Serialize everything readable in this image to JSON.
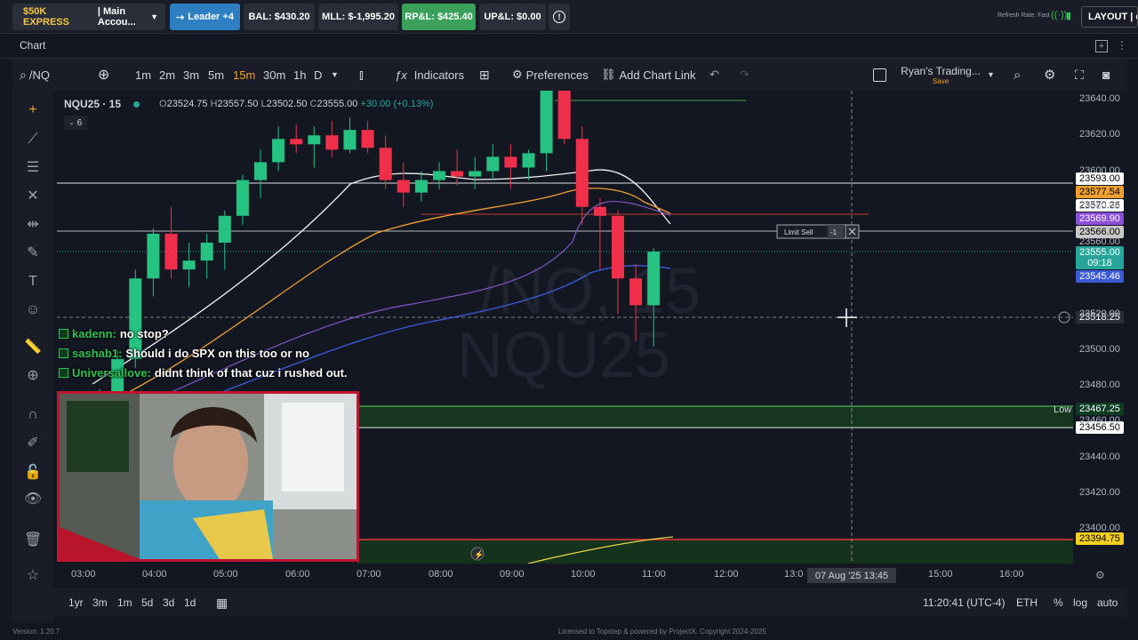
{
  "topbar": {
    "account_prefix": "$50K EXPRESS",
    "account_suffix": "| Main Accou...",
    "leader": "Leader +4",
    "bal": "BAL: $430.20",
    "mll": "MLL: $-1,995.20",
    "rpl": "RP&L: $425.40",
    "upl": "UP&L: $0.00",
    "refresh": "Refresh Rate: Fast",
    "layout": "LAYOUT | de"
  },
  "chart_tab": "Chart",
  "toolbar": {
    "symbol": "/NQ",
    "timeframes": [
      "1m",
      "2m",
      "3m",
      "5m",
      "15m",
      "30m",
      "1h",
      "D"
    ],
    "active_timeframe": "15m",
    "indicators": "Indicators",
    "preferences": "Preferences",
    "add_chart_link": "Add Chart Link",
    "layout_name": "Ryan's Trading...",
    "save": "Save"
  },
  "legend": {
    "title": "NQU25 · 15",
    "o": "23524.75",
    "h": "23557.50",
    "l": "23502.50",
    "c": "23555.00",
    "chg": "+30.00 (+0.13%)",
    "collapse": "6"
  },
  "watermark": {
    "line1": "/NQ, 15",
    "line2": "NQU25"
  },
  "order": {
    "label": "Limit Sell",
    "qty": "-1"
  },
  "low_label": "Low",
  "yaxis": {
    "ticks": [
      "23640.00",
      "23620.00",
      "23600.00",
      "23580.00",
      "23560.00",
      "23520.00",
      "23500.00",
      "23480.00",
      "23460.00",
      "23440.00",
      "23420.00",
      "23400.00"
    ],
    "tags": [
      {
        "text": "23593.00",
        "color": "#ffffff"
      },
      {
        "text": "23577.54",
        "color": "#f0a030"
      },
      {
        "text": "23570.26",
        "color": "#ffffff"
      },
      {
        "text": "23569.90",
        "color": "#8a4fd6"
      },
      {
        "text": "23566.00",
        "color": "#c8c8c8"
      },
      {
        "text": "23555.00",
        "color": "#26a69a"
      },
      {
        "text": "09:18",
        "color": "#26a69a"
      },
      {
        "text": "23545.46",
        "color": "#3b5bd6"
      },
      {
        "text": "23518.25",
        "color": "#2a2e39"
      },
      {
        "text": "23467.25",
        "color": "#0f3d22"
      },
      {
        "text": "23456.50",
        "color": "#ffffff"
      },
      {
        "text": "23394.75",
        "color": "#f5d020"
      }
    ]
  },
  "xaxis": {
    "ticks": [
      "03:00",
      "04:00",
      "05:00",
      "06:00",
      "07:00",
      "08:00",
      "09:00",
      "10:00",
      "11:00",
      "12:00",
      "13:0",
      "15:00",
      "16:00"
    ],
    "crosshair_time": "07 Aug '25  13:45"
  },
  "chat": [
    {
      "user": "kadenn:",
      "msg": "no stop?"
    },
    {
      "user": "sashab1:",
      "msg": "Should i do SPX on this too or no"
    },
    {
      "user": "Universallove:",
      "msg": "didnt think of that cuz i rushed out."
    }
  ],
  "bottom": {
    "ranges": [
      "1yr",
      "3m",
      "1m",
      "5d",
      "3d",
      "1d"
    ],
    "clock": "11:20:41 (UTC-4)",
    "session": "ETH",
    "pct": "%",
    "log": "log",
    "auto": "auto"
  },
  "footer": {
    "version": "Version: 1.20.7",
    "license": "Licensed to Topstep & powered by ProjectX. Copyright 2024-2025"
  },
  "chart_data": {
    "type": "candlestick",
    "x_labels": [
      "03:00",
      "04:00",
      "05:00",
      "06:00",
      "07:00",
      "08:00",
      "09:00",
      "10:00",
      "11:00",
      "12:00",
      "13:00",
      "15:00",
      "16:00"
    ],
    "ylim": [
      23390,
      23645
    ],
    "candles": [
      [
        23455,
        23470,
        23440,
        23465
      ],
      [
        23465,
        23478,
        23455,
        23470
      ],
      [
        23470,
        23500,
        23462,
        23495
      ],
      [
        23495,
        23545,
        23490,
        23540
      ],
      [
        23540,
        23568,
        23530,
        23565
      ],
      [
        23565,
        23580,
        23540,
        23545
      ],
      [
        23545,
        23560,
        23535,
        23550
      ],
      [
        23550,
        23565,
        23540,
        23560
      ],
      [
        23560,
        23578,
        23545,
        23575
      ],
      [
        23575,
        23598,
        23570,
        23595
      ],
      [
        23595,
        23612,
        23585,
        23605
      ],
      [
        23605,
        23625,
        23600,
        23618
      ],
      [
        23618,
        23626,
        23610,
        23615
      ],
      [
        23615,
        23625,
        23602,
        23620
      ],
      [
        23620,
        23628,
        23608,
        23612
      ],
      [
        23612,
        23630,
        23610,
        23623
      ],
      [
        23623,
        23628,
        23610,
        23613
      ],
      [
        23613,
        23620,
        23590,
        23595
      ],
      [
        23595,
        23605,
        23580,
        23588
      ],
      [
        23588,
        23600,
        23583,
        23595
      ],
      [
        23595,
        23605,
        23590,
        23600
      ],
      [
        23600,
        23612,
        23592,
        23597
      ],
      [
        23597,
        23608,
        23590,
        23600
      ],
      [
        23600,
        23615,
        23595,
        23608
      ],
      [
        23608,
        23615,
        23590,
        23602
      ],
      [
        23602,
        23612,
        23595,
        23610
      ],
      [
        23610,
        23660,
        23600,
        23648
      ],
      [
        23648,
        23650,
        23615,
        23618
      ],
      [
        23618,
        23625,
        23570,
        23580
      ],
      [
        23580,
        23585,
        23545,
        23575
      ],
      [
        23575,
        23578,
        23520,
        23540
      ],
      [
        23540,
        23548,
        23505,
        23525
      ],
      [
        23525,
        23557,
        23502,
        23555
      ]
    ],
    "horizontal_levels": [
      {
        "value": 23593.0,
        "color": "#ffffff"
      },
      {
        "value": 23566.0,
        "color": "#c8c8c8"
      },
      {
        "value": 23467.25,
        "color": "#2e7d32",
        "label": "Low"
      },
      {
        "value": 23456.5,
        "color": "#ffffff"
      },
      {
        "value": 23394.75,
        "color": "#e53935"
      }
    ]
  }
}
